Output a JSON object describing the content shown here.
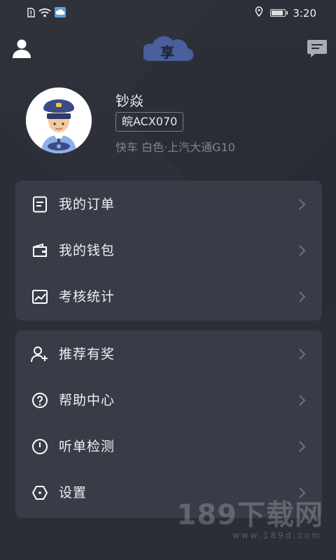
{
  "status_bar": {
    "time": "3:20",
    "icons": [
      "sim-alert-icon",
      "wifi-icon",
      "cloud-app-icon",
      "location-icon",
      "battery-icon"
    ],
    "battery_level": 0.9
  },
  "header": {
    "logo_char": "享",
    "left_icon": "user-profile-icon",
    "right_icon": "message-icon"
  },
  "profile": {
    "name": "钞焱",
    "plate": "皖ACX070",
    "car_info": "快车 白色·上汽大通G10"
  },
  "menu_group_1": [
    {
      "label": "我的订单",
      "icon": "order-list-icon"
    },
    {
      "label": "我的钱包",
      "icon": "wallet-icon"
    },
    {
      "label": "考核统计",
      "icon": "statistics-chart-icon"
    }
  ],
  "menu_group_2": [
    {
      "label": "推荐有奖",
      "icon": "add-user-icon"
    },
    {
      "label": "帮助中心",
      "icon": "help-question-icon"
    },
    {
      "label": "听单检测",
      "icon": "clock-check-icon"
    },
    {
      "label": "设置",
      "icon": "settings-hexagon-icon"
    }
  ],
  "watermark": {
    "main": "189下载网",
    "sub": "www.189d.com"
  },
  "colors": {
    "background": "#2b2e37",
    "card": "#393c47",
    "logo": "#4a5f9c",
    "text": "#f0f0f2",
    "muted": "#80838c"
  }
}
